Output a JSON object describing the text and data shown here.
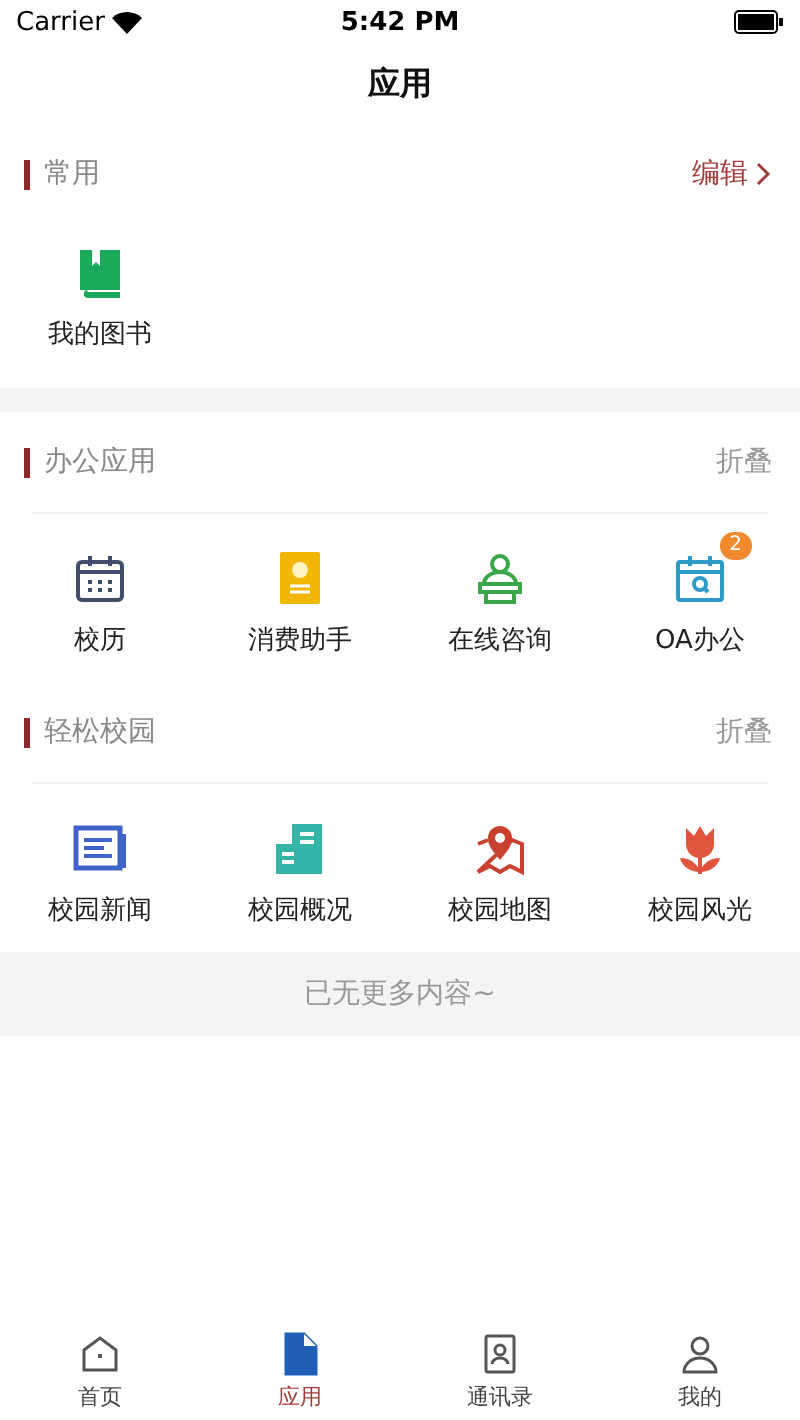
{
  "status_bar": {
    "carrier": "Carrier",
    "time": "5:42 PM"
  },
  "nav": {
    "title": "应用"
  },
  "sections": [
    {
      "title": "常用",
      "action": "编辑",
      "kind": "edit",
      "apps": [
        {
          "label": "我的图书",
          "kind": "book"
        }
      ]
    },
    {
      "title": "办公应用",
      "action": "折叠",
      "kind": "fold",
      "apps": [
        {
          "label": "校历",
          "kind": "calendar"
        },
        {
          "label": "消费助手",
          "kind": "wallet"
        },
        {
          "label": "在线咨询",
          "kind": "consult"
        },
        {
          "label": "OA办公",
          "kind": "calsearch",
          "badge": "2"
        }
      ]
    },
    {
      "title": "轻松校园",
      "action": "折叠",
      "kind": "fold",
      "apps": [
        {
          "label": "校园新闻",
          "kind": "news"
        },
        {
          "label": "校园概况",
          "kind": "building"
        },
        {
          "label": "校园地图",
          "kind": "map"
        },
        {
          "label": "校园风光",
          "kind": "flower"
        }
      ]
    }
  ],
  "footer": "已无更多内容~",
  "tab_bar": [
    {
      "label": "首页",
      "kind": "home",
      "selected": false
    },
    {
      "label": "应用",
      "kind": "file",
      "selected": true
    },
    {
      "label": "通讯录",
      "kind": "contacts",
      "selected": false
    },
    {
      "label": "我的",
      "kind": "person",
      "selected": false
    }
  ]
}
